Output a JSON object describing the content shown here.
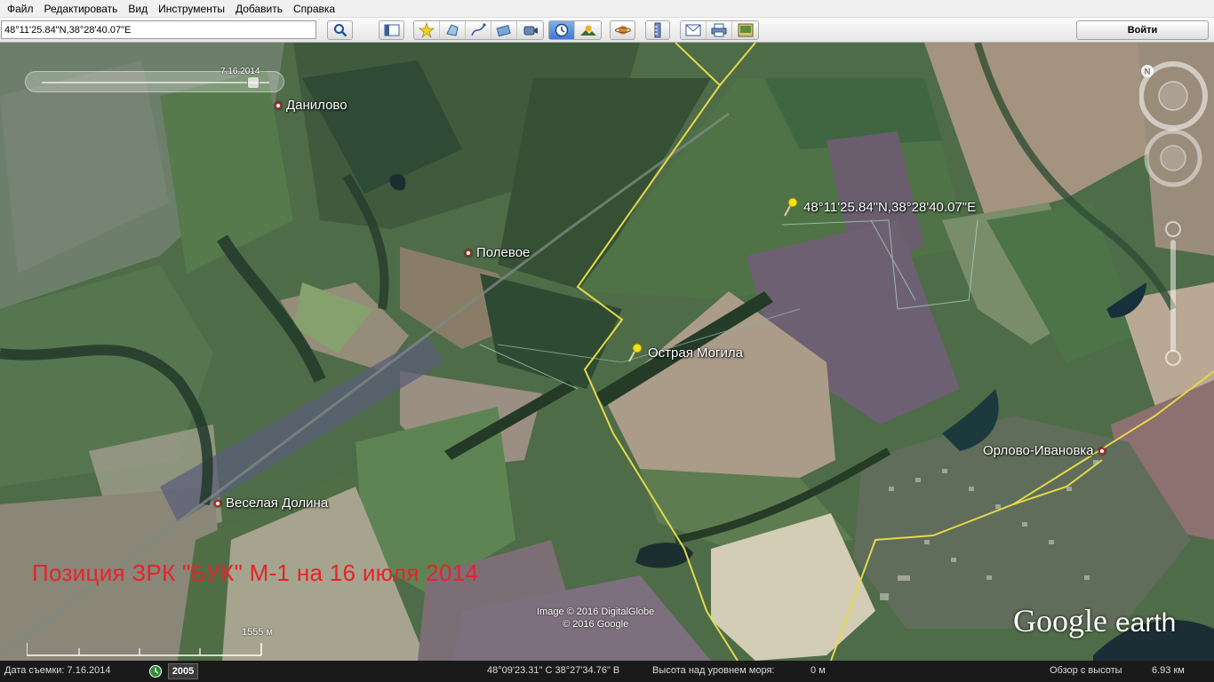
{
  "menu": {
    "items": [
      "Файл",
      "Редактировать",
      "Вид",
      "Инструменты",
      "Добавить",
      "Справка"
    ]
  },
  "toolbar": {
    "search_value": "48°11'25.84\"N,38°28'40.07\"E",
    "search_icon": "magnifier-icon",
    "signin_label": "Войти",
    "tools": [
      {
        "icon": "sidebar-icon"
      },
      {
        "icon": "placemark-icon"
      },
      {
        "icon": "polygon-icon"
      },
      {
        "icon": "path-icon"
      },
      {
        "icon": "image-overlay-icon"
      },
      {
        "icon": "record-tour-icon"
      },
      {
        "icon": "historical-imagery-icon"
      },
      {
        "icon": "sunlight-icon"
      },
      {
        "icon": "planets-icon"
      },
      {
        "icon": "ruler-icon"
      },
      {
        "icon": "email-icon"
      },
      {
        "icon": "print-icon"
      },
      {
        "icon": "save-image-icon"
      }
    ]
  },
  "map": {
    "time_slider_date": "7.16.2014",
    "time_slider_fraction": 0.93,
    "places": [
      {
        "name": "Данилово"
      },
      {
        "name": "Полевое"
      },
      {
        "name": "Веселая Долина"
      },
      {
        "name": "Орлово-Ивановка"
      }
    ],
    "pins": [
      {
        "label": "48°11'25.84\"N,38°28'40.07\"E"
      },
      {
        "label": "Острая Могила"
      }
    ],
    "annotation": "Позиция ЗРК \"БУК\" М-1 на 16 июля 2014",
    "copyright": [
      "Image © 2016 DigitalGlobe",
      "© 2016 Google"
    ],
    "scale_label": "1555 м",
    "logo_google": "Google",
    "logo_earth": "earth",
    "colors": {
      "annotation": "#e8222a",
      "border_line": "#e6d84a",
      "pin": "#f2e21c"
    }
  },
  "status": {
    "capture_date": "Дата съемки: 7.16.2014",
    "year": "2005",
    "coords": "48°09'23.31\" С  38°27'34.76\" В",
    "elevation": "Высота над уровнем моря:",
    "elevation_value": "0 м",
    "eye_alt_label": "Обзор с высоты",
    "eye_alt_value": "6.93 км"
  }
}
